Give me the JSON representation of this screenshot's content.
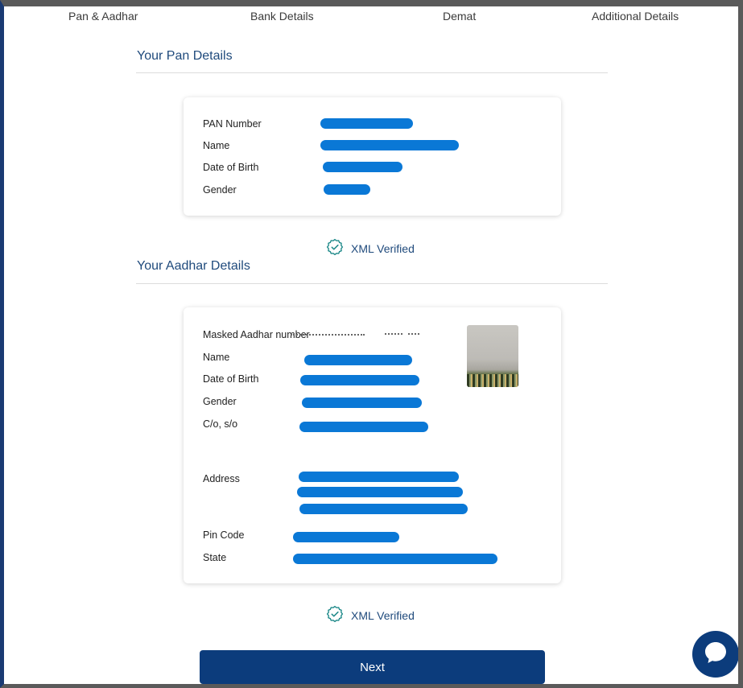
{
  "steps": [
    "Pan & Aadhar",
    "Bank Details",
    "Demat",
    "Additional Details"
  ],
  "pan_section": {
    "title": "Your Pan Details",
    "fields": [
      {
        "label": "PAN Number"
      },
      {
        "label": "Name"
      },
      {
        "label": "Date of Birth"
      },
      {
        "label": "Gender"
      }
    ],
    "verified_label": "XML Verified"
  },
  "aadhar_section": {
    "title": "Your Aadhar Details",
    "fields": [
      {
        "label": "Masked Aadhar number"
      },
      {
        "label": "Name"
      },
      {
        "label": "Date of Birth"
      },
      {
        "label": "Gender"
      },
      {
        "label": "C/o, s/o"
      },
      {
        "label": "Address"
      },
      {
        "label": "Pin Code"
      },
      {
        "label": "State"
      }
    ],
    "verified_label": "XML Verified"
  },
  "next_button": {
    "label": "Next"
  },
  "icons": {
    "verified": "badge-check-icon",
    "chat": "chat-bubble-icon"
  },
  "colors": {
    "primary": "#0c3c7c",
    "title": "#1f4a7c",
    "redaction": "#0a78d6",
    "verified_icon": "#1f8a8a"
  }
}
